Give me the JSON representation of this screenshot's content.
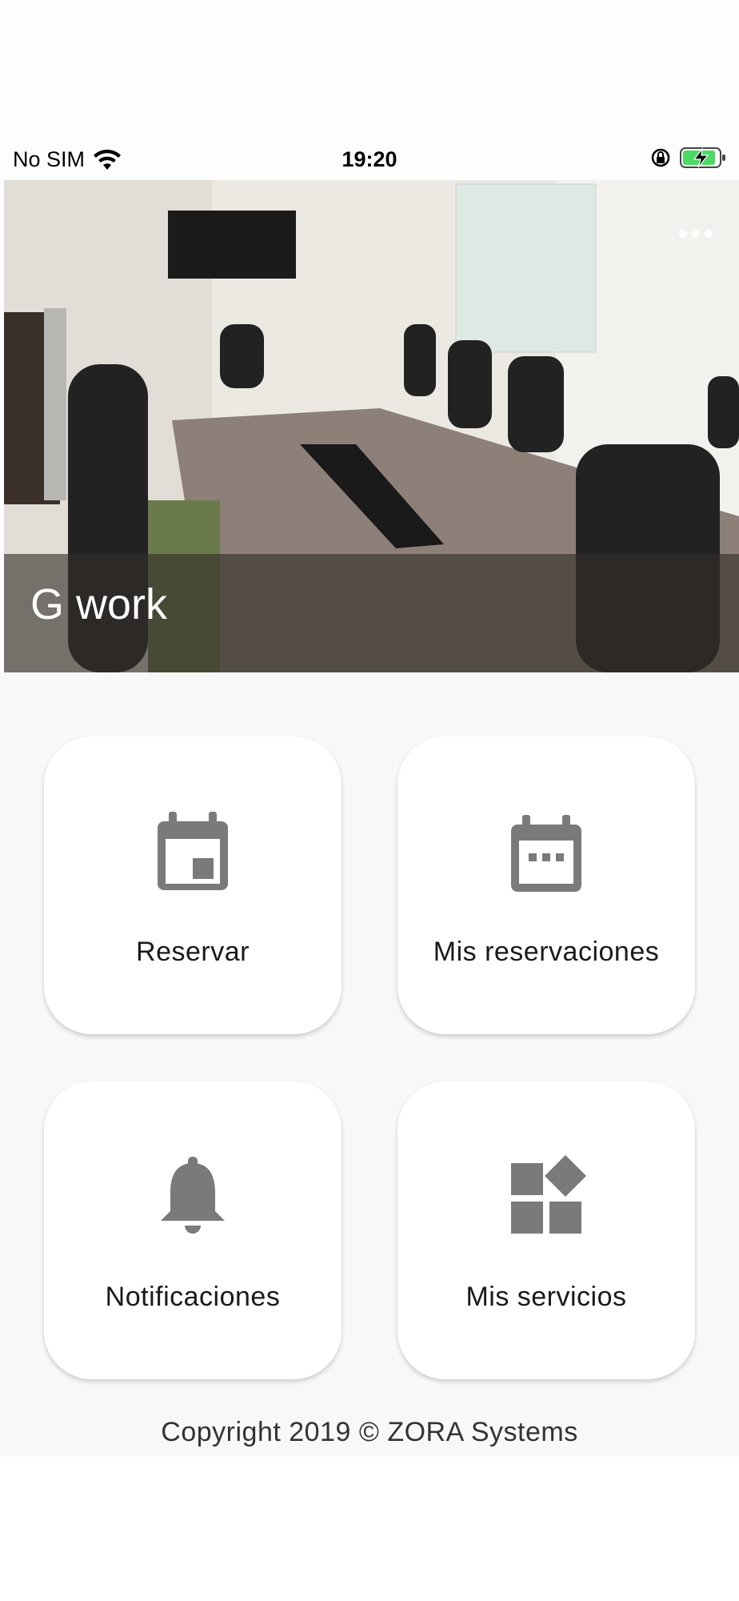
{
  "status_bar": {
    "carrier": "No SIM",
    "time": "19:20"
  },
  "hero": {
    "title": "G work"
  },
  "tiles": [
    {
      "label": "Reservar",
      "icon": "calendar-event-icon"
    },
    {
      "label": "Mis reservaciones",
      "icon": "calendar-month-icon"
    },
    {
      "label": "Notificaciones",
      "icon": "bell-icon"
    },
    {
      "label": "Mis servicios",
      "icon": "widgets-icon"
    }
  ],
  "footer": {
    "copyright": "Copyright 2019 © ZORA Systems"
  },
  "colors": {
    "icon_gray": "#7a7a7a",
    "tile_bg": "#ffffff",
    "page_bg": "#f8f8f8"
  }
}
